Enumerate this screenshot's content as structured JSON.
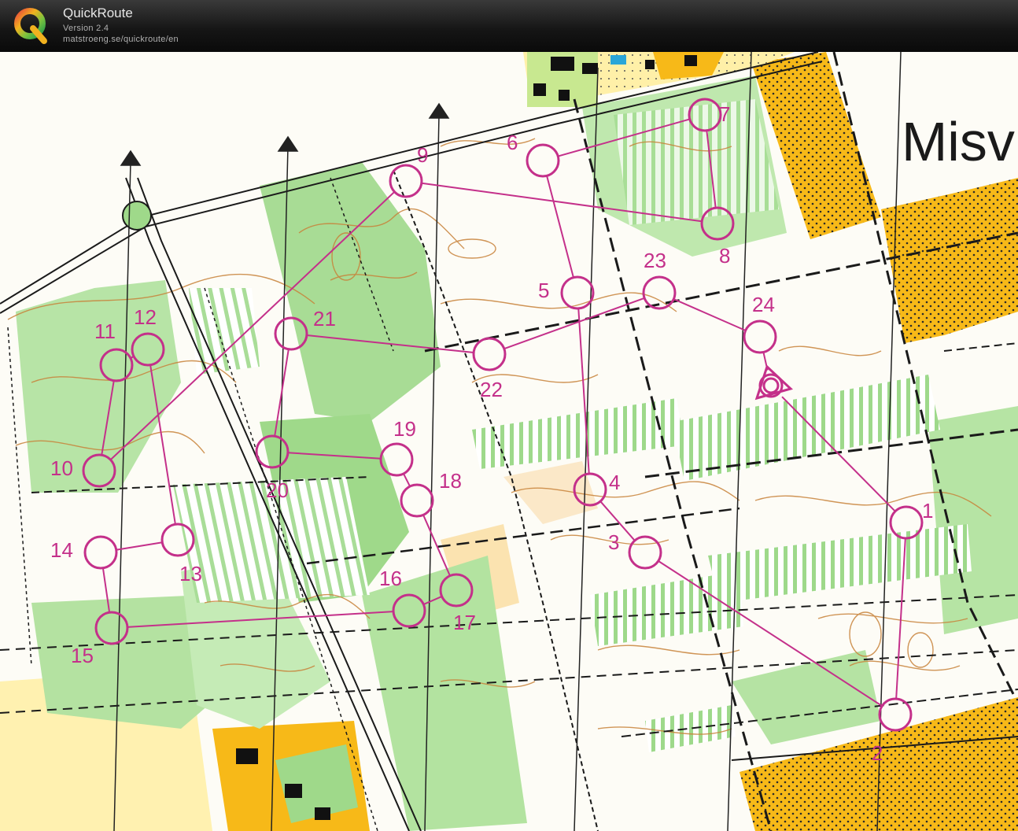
{
  "app": {
    "name": "QuickRoute",
    "version": "Version 2.4",
    "url": "matstroeng.se/quickroute/en",
    "logo_letter": "Q"
  },
  "map": {
    "place_label": "Misv",
    "course_color": "#c4308a",
    "controls": [
      {
        "label": "1"
      },
      {
        "label": "2"
      },
      {
        "label": "3"
      },
      {
        "label": "4"
      },
      {
        "label": "5"
      },
      {
        "label": "6"
      },
      {
        "label": "7"
      },
      {
        "label": "8"
      },
      {
        "label": "9"
      },
      {
        "label": "10"
      },
      {
        "label": "11"
      },
      {
        "label": "12"
      },
      {
        "label": "13"
      },
      {
        "label": "14"
      },
      {
        "label": "15"
      },
      {
        "label": "16"
      },
      {
        "label": "17"
      },
      {
        "label": "18"
      },
      {
        "label": "19"
      },
      {
        "label": "20"
      },
      {
        "label": "21"
      },
      {
        "label": "22"
      },
      {
        "label": "23"
      },
      {
        "label": "24"
      }
    ]
  }
}
